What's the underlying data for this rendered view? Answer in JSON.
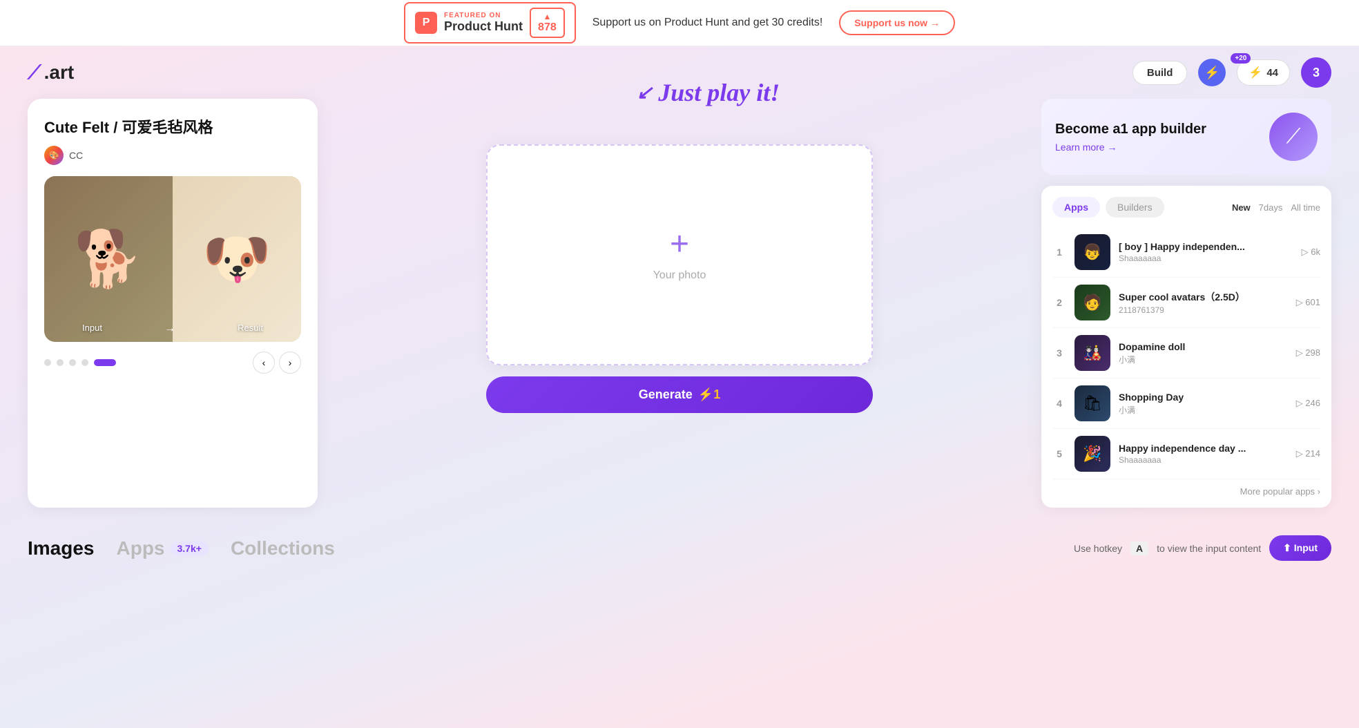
{
  "banner": {
    "featured_label": "FEATURED ON",
    "ph_name": "Product Hunt",
    "ph_count": "878",
    "description": "Support us on Product Hunt and get 30 credits!",
    "support_btn": "Support us now →"
  },
  "header": {
    "logo_text": ".art",
    "build_label": "Build",
    "credits_badge": "+20",
    "credits_count": "44",
    "avatar_letter": "3"
  },
  "hero": {
    "just_play": "Just play it!"
  },
  "left_panel": {
    "title": "Cute Felt / 可爱毛毡风格",
    "author": "CC",
    "input_label": "Input",
    "result_label": "Result"
  },
  "upload": {
    "plus": "+",
    "text": "Your photo"
  },
  "generate_btn": {
    "label": "Generate",
    "cost": "⚡1"
  },
  "promo": {
    "title": "Become a1 app builder",
    "link": "Learn more →"
  },
  "leaderboard": {
    "tab_apps": "Apps",
    "tab_builders": "Builders",
    "time_new": "New",
    "time_7days": "7days",
    "time_all": "All time",
    "items": [
      {
        "rank": "1",
        "name": "[ boy ] Happy independen...",
        "author": "Shaaaaaaa",
        "plays": "6k"
      },
      {
        "rank": "2",
        "name": "Super cool avatars（2.5D）",
        "author": "2118761379",
        "plays": "601"
      },
      {
        "rank": "3",
        "name": "Dopamine doll",
        "author": "小满",
        "plays": "298"
      },
      {
        "rank": "4",
        "name": "Shopping Day",
        "author": "小满",
        "plays": "246"
      },
      {
        "rank": "5",
        "name": "Happy independence day ...",
        "author": "Shaaaaaaa",
        "plays": "214"
      }
    ],
    "more_link": "More popular apps ›"
  },
  "bottom": {
    "tab_images": "Images",
    "tab_apps": "Apps",
    "apps_count": "3.7k+",
    "tab_collections": "Collections",
    "hotkey_label": "Use hotkey",
    "hotkey_key": "A",
    "hotkey_suffix": "to view the input content",
    "input_btn": "⬆ Input"
  }
}
